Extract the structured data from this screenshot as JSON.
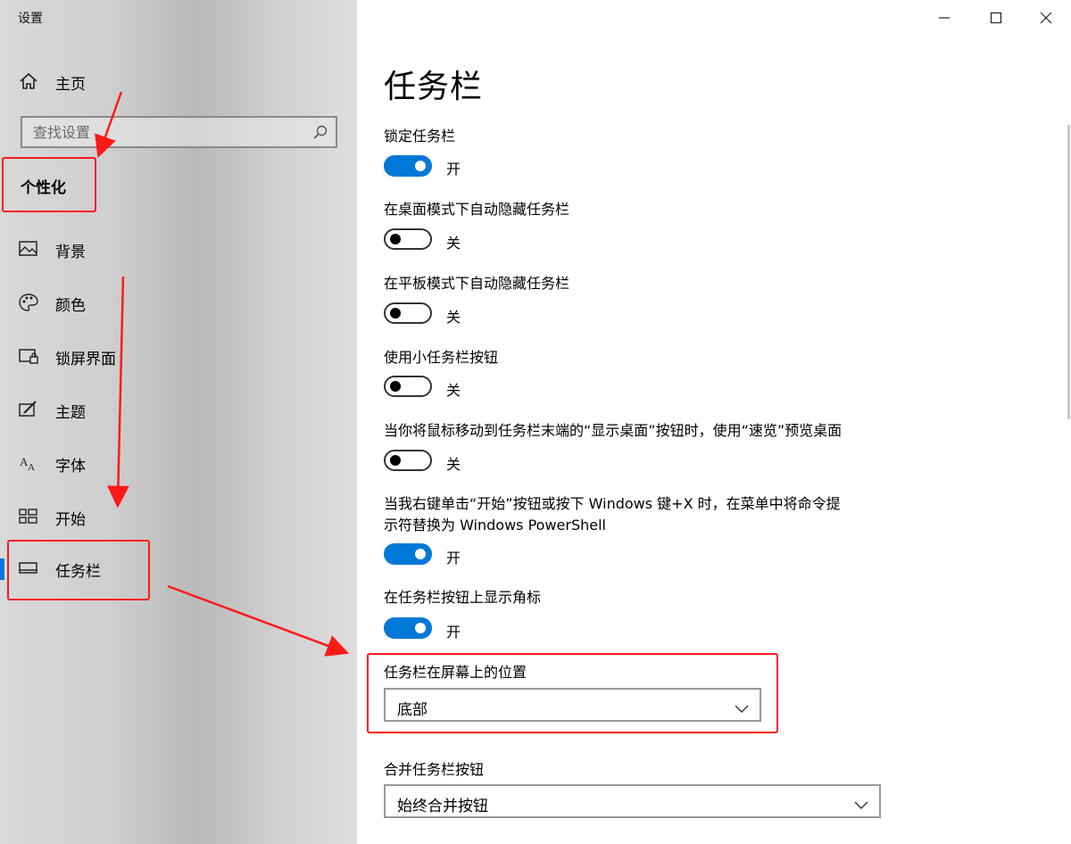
{
  "window": {
    "title": "设置"
  },
  "sidebar": {
    "home_label": "主页",
    "search_placeholder": "查找设置",
    "category": "个性化",
    "items": [
      {
        "label": "背景",
        "icon": "picture-icon"
      },
      {
        "label": "颜色",
        "icon": "palette-icon"
      },
      {
        "label": "锁屏界面",
        "icon": "lock-screen-icon"
      },
      {
        "label": "主题",
        "icon": "theme-icon"
      },
      {
        "label": "字体",
        "icon": "font-icon"
      },
      {
        "label": "开始",
        "icon": "start-icon"
      },
      {
        "label": "任务栏",
        "icon": "taskbar-icon",
        "selected": true
      }
    ]
  },
  "main": {
    "title": "任务栏",
    "settings": [
      {
        "label": "锁定任务栏",
        "state": "开",
        "on": true
      },
      {
        "label": "在桌面模式下自动隐藏任务栏",
        "state": "关",
        "on": false
      },
      {
        "label": "在平板模式下自动隐藏任务栏",
        "state": "关",
        "on": false
      },
      {
        "label": "使用小任务栏按钮",
        "state": "关",
        "on": false
      },
      {
        "label": "当你将鼠标移动到任务栏末端的“显示桌面”按钮时，使用“速览”预览桌面",
        "state": "关",
        "on": false
      },
      {
        "label_line1": "当我右键单击“开始”按钮或按下 Windows 键+X 时，在菜单中将命令提",
        "label_line2": "示符替换为 Windows PowerShell",
        "state": "开",
        "on": true
      },
      {
        "label": "在任务栏按钮上显示角标",
        "state": "开",
        "on": true
      }
    ],
    "position": {
      "label": "任务栏在屏幕上的位置",
      "value": "底部"
    },
    "combine": {
      "label": "合并任务栏按钮",
      "value": "始终合并按钮"
    }
  },
  "colors": {
    "accent": "#0078d7",
    "annotation": "#ff1a1a"
  }
}
